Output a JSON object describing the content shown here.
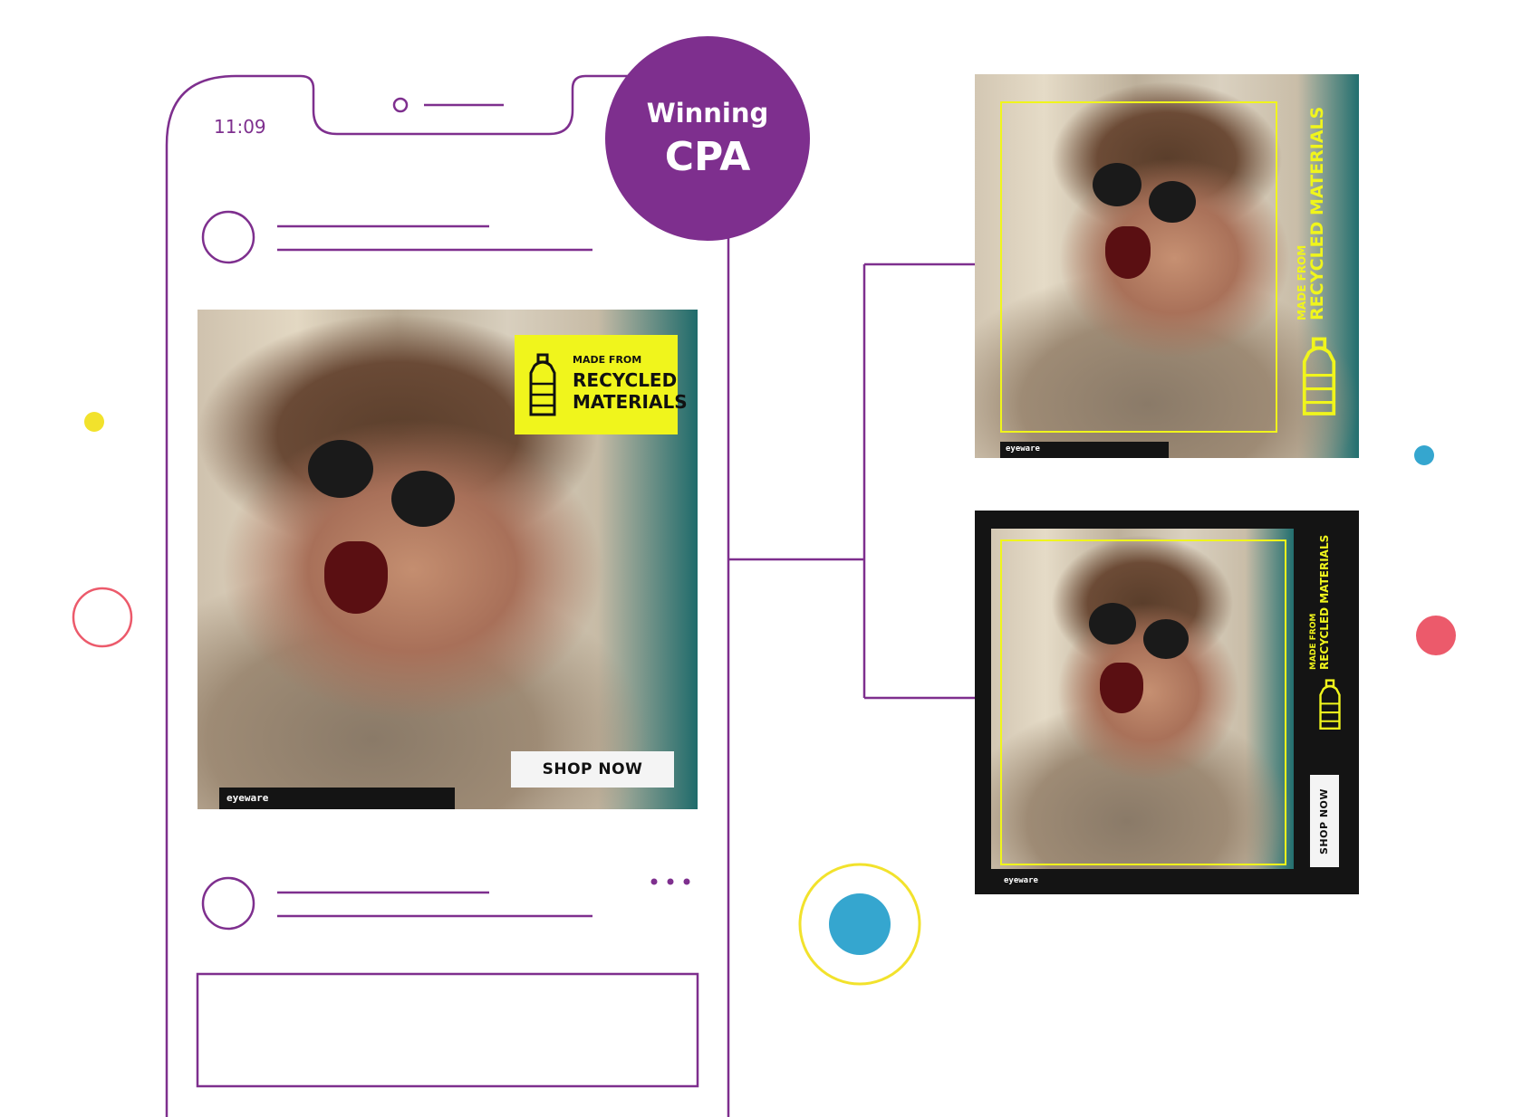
{
  "phone": {
    "time": "11:09"
  },
  "badge": {
    "line1": "Winning",
    "line2": "CPA",
    "color": "#7e2f8e"
  },
  "ad_main": {
    "label_small": "MADE FROM",
    "label_line1": "RECYCLED",
    "label_line2": "MATERIALS",
    "brand": "eyeware",
    "cta": "SHOP NOW"
  },
  "variant_a": {
    "label_small": "MADE FROM",
    "label_big": "RECYCLED MATERIALS",
    "brand": "eyeware"
  },
  "variant_b": {
    "label_small": "MADE FROM",
    "label_big": "RECYCLED MATERIALS",
    "brand": "eyeware",
    "cta": "SHOP NOW"
  },
  "colors": {
    "outline": "#7e2f8e",
    "accent_yellow": "#f0f51c",
    "dot_yellow": "#f2e22c",
    "dot_blue": "#35a6cf",
    "dot_red": "#ec5a6b"
  },
  "icons": [
    "bottle-icon",
    "more-dots-icon"
  ]
}
